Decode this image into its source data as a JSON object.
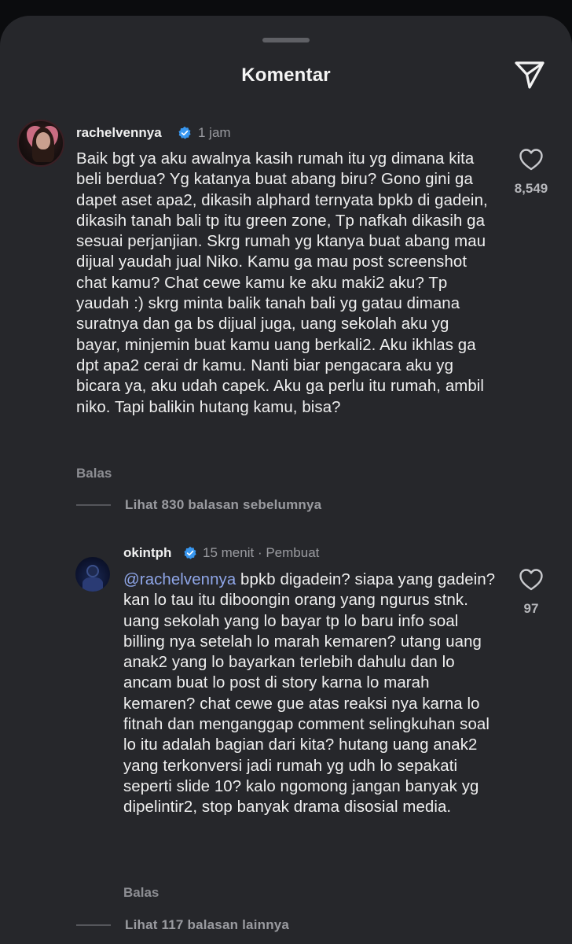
{
  "header": {
    "title": "Komentar"
  },
  "comments": [
    {
      "username": "rachelvennya",
      "time": "1 jam",
      "text": "Baik bgt ya aku awalnya kasih rumah itu yg dimana kita beli berdua? Yg katanya buat abang biru? Gono gini ga dapet aset apa2, dikasih alphard ternyata bpkb di gadein, dikasih tanah bali tp itu green zone, Tp nafkah dikasih ga sesuai perjanjian. Skrg rumah yg ktanya buat abang mau dijual yaudah jual Niko. Kamu ga mau post screenshot chat kamu? Chat cewe kamu ke aku maki2 aku? Tp yaudah :) skrg minta balik tanah bali yg gatau dimana suratnya dan ga bs dijual juga, uang sekolah aku yg bayar, minjemin buat kamu uang berkali2. Aku ikhlas ga dpt apa2 cerai dr kamu. Nanti biar pengacara aku yg bicara ya, aku udah capek. Aku ga perlu itu rumah, ambil niko. Tapi balikin hutang kamu, bisa?",
      "reply_label": "Balas",
      "likes": "8,549",
      "view_replies": "Lihat 830 balasan sebelumnya"
    },
    {
      "username": "okintph",
      "time": "15 menit",
      "separator": "·",
      "creator_tag": "Pembuat",
      "mention": "@rachelvennya",
      "text": " bpkb digadein? siapa yang gadein? kan lo tau itu diboongin orang yang ngurus stnk. uang sekolah yang lo bayar tp lo baru info soal billing nya setelah lo marah kemaren? utang uang anak2 yang lo bayarkan terlebih dahulu dan lo ancam buat lo post di story karna lo marah kemaren? chat cewe gue atas reaksi nya karna lo fitnah dan menganggap comment selingkuhan soal lo itu adalah bagian dari kita? hutang uang anak2 yang terkonversi jadi rumah yg udh lo sepakati seperti slide 10? kalo ngomong jangan banyak yg dipelintir2, stop banyak drama disosial media.",
      "reply_label": "Balas",
      "likes": "97",
      "view_replies": "Lihat 117 balasan lainnya"
    }
  ],
  "colors": {
    "sheet": "#26272b",
    "mention": "#8fa6e8",
    "verified": "#3897f0"
  },
  "icons": [
    "send-icon",
    "heart-icon",
    "verified-badge-icon"
  ]
}
